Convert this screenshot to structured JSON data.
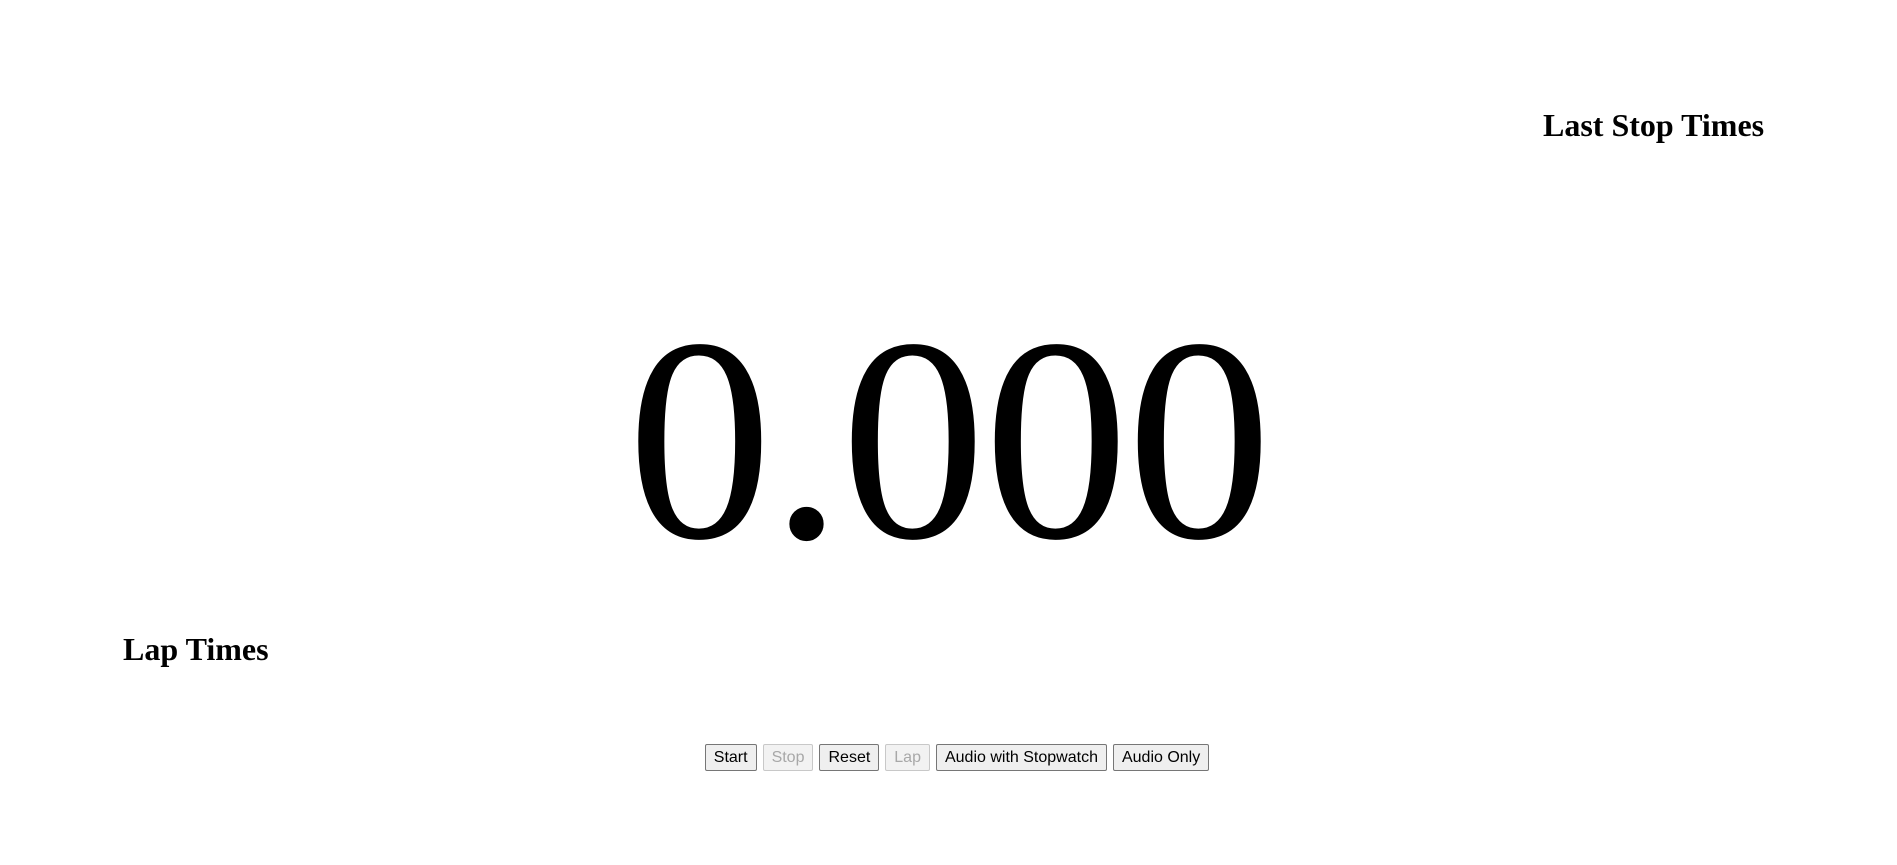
{
  "stop_times": {
    "heading": "Last Stop Times"
  },
  "timer": {
    "display": "0.000"
  },
  "lap_times": {
    "heading": "Lap Times"
  },
  "controls": {
    "start_label": "Start",
    "stop_label": "Stop",
    "reset_label": "Reset",
    "lap_label": "Lap",
    "audio_with_stopwatch_label": "Audio with Stopwatch",
    "audio_only_label": "Audio Only"
  }
}
